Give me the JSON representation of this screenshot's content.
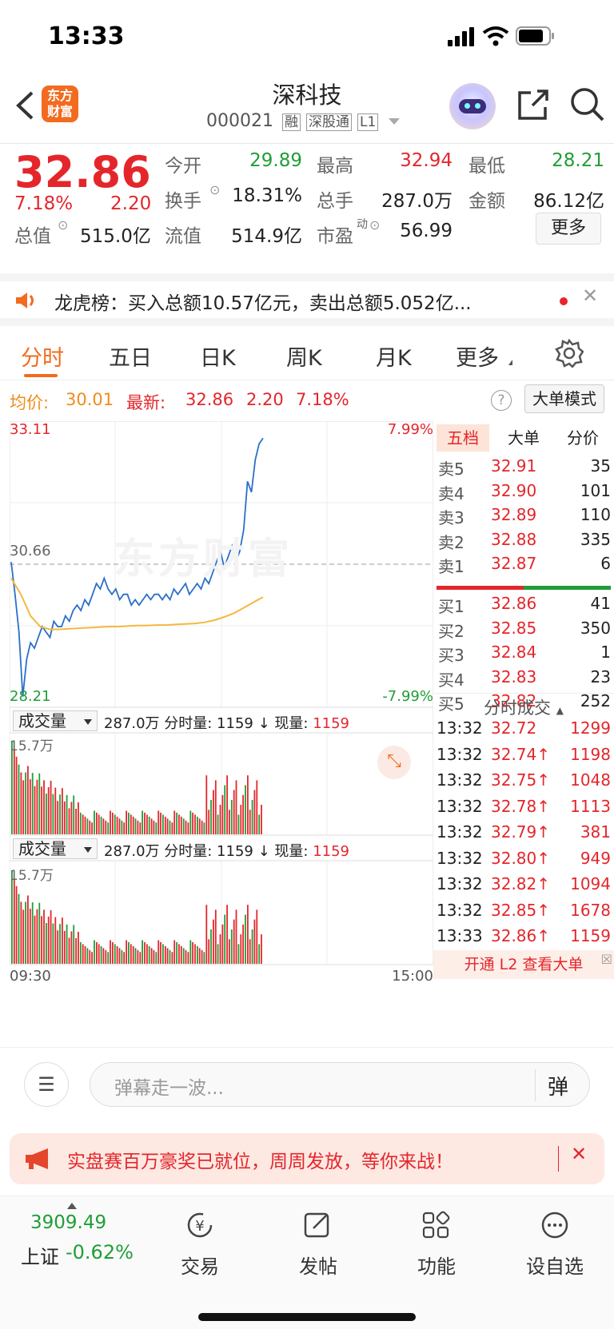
{
  "status_bar": {
    "time": "13:33"
  },
  "header": {
    "title": "深科技",
    "code": "000021",
    "tags": [
      "融",
      "深股通",
      "L1"
    ],
    "logo_text": "东方财富"
  },
  "quote": {
    "price": "32.86",
    "change_pct": "7.18%",
    "change": "2.20",
    "open_label": "今开",
    "open": "29.89",
    "high_label": "最高",
    "high": "32.94",
    "low_label": "最低",
    "low": "28.21",
    "turnover_label": "换手",
    "turnover": "18.31%",
    "volume_label": "总手",
    "volume": "287.0万",
    "amount_label": "金额",
    "amount": "86.12亿",
    "mktcap_label": "总值",
    "mktcap": "515.0亿",
    "float_label": "流值",
    "float": "514.9亿",
    "pe_label": "市盈",
    "pe_sup": "动",
    "pe": "56.99",
    "more_button": "更多"
  },
  "notice": {
    "text": "龙虎榜：买入总额10.57亿元，卖出总额5.052亿..."
  },
  "tabs": [
    "分时",
    "五日",
    "日K",
    "周K",
    "月K",
    "更多"
  ],
  "info_bar": {
    "avg_label": "均价:",
    "avg": "30.01",
    "latest_label": "最新:",
    "latest": "32.86",
    "chg": "2.20",
    "pct": "7.18%",
    "help_icon": "?",
    "mode_button": "大单模式"
  },
  "chart": {
    "y_top": "33.11",
    "y_mid": "30.66",
    "y_bottom": "28.21",
    "pct_top": "7.99%",
    "pct_bottom": "-7.99%",
    "watermark": "东方财富",
    "vol_label": "成交量",
    "vol_total": "287.0万",
    "vol_info": "分时量: 1159 ↓ 现量:",
    "vol_now": "1159",
    "vol_max": "15.7万",
    "time_start": "09:30",
    "time_end": "15:00"
  },
  "chart_data": {
    "type": "line",
    "series": [
      {
        "values": [
          30.7,
          30.1,
          29.4,
          28.2,
          28.9,
          29.2,
          29.1,
          29.3,
          29.5,
          29.4,
          29.3,
          29.6,
          29.5,
          29.5,
          29.7,
          29.6,
          29.8,
          29.9,
          29.8,
          30.0,
          29.9,
          30.1,
          30.3,
          30.2,
          30.4,
          30.2,
          30.1,
          30.2,
          30.0,
          30.1,
          30.1,
          29.9,
          30.0,
          29.9,
          30.0,
          30.1,
          30.0,
          30.1,
          30.1,
          30.0,
          30.1,
          30.0,
          30.2,
          30.1,
          30.2,
          30.3,
          30.1,
          30.2,
          30.3,
          30.2,
          30.4,
          30.3,
          30.5,
          30.7,
          30.9,
          30.6,
          30.8,
          31.0,
          30.7,
          30.9,
          31.3,
          32.2,
          32.0,
          32.6,
          32.9,
          33.0
        ]
      },
      {
        "values": [
          30.4,
          30.1,
          29.7,
          29.5,
          29.45,
          29.45,
          29.46,
          29.47,
          29.48,
          29.49,
          29.5,
          29.5,
          29.51,
          29.52,
          29.52,
          29.53,
          29.53,
          29.54,
          29.55,
          29.56,
          29.58,
          29.62,
          29.68,
          29.75,
          29.85,
          29.95,
          30.05
        ]
      }
    ],
    "ylim": [
      28.21,
      33.11
    ]
  },
  "order_book": {
    "tabs": [
      "五档",
      "大单",
      "分价"
    ],
    "asks": [
      {
        "label": "卖5",
        "price": "32.91",
        "vol": "35"
      },
      {
        "label": "卖4",
        "price": "32.90",
        "vol": "101"
      },
      {
        "label": "卖3",
        "price": "32.89",
        "vol": "110"
      },
      {
        "label": "卖2",
        "price": "32.88",
        "vol": "335"
      },
      {
        "label": "卖1",
        "price": "32.87",
        "vol": "6"
      }
    ],
    "bids": [
      {
        "label": "买1",
        "price": "32.86",
        "vol": "41"
      },
      {
        "label": "买2",
        "price": "32.85",
        "vol": "350"
      },
      {
        "label": "买3",
        "price": "32.84",
        "vol": "1"
      },
      {
        "label": "买4",
        "price": "32.83",
        "vol": "23"
      },
      {
        "label": "买5",
        "price": "32.82",
        "vol": "252"
      }
    ],
    "trades_title": "分时成交",
    "trades": [
      {
        "time": "13:32",
        "price": "32.72",
        "vol": "1299",
        "dir": "",
        "c": "red"
      },
      {
        "time": "13:32",
        "price": "32.74↑",
        "vol": "1198",
        "dir": "",
        "c": "red"
      },
      {
        "time": "13:32",
        "price": "32.75↑",
        "vol": "1048",
        "dir": "",
        "c": "red"
      },
      {
        "time": "13:32",
        "price": "32.78↑",
        "vol": "1113",
        "dir": "",
        "c": "red"
      },
      {
        "time": "13:32",
        "price": "32.79↑",
        "vol": "381",
        "dir": "",
        "c": "red"
      },
      {
        "time": "13:32",
        "price": "32.80↑",
        "vol": "949",
        "dir": "",
        "c": "red"
      },
      {
        "time": "13:32",
        "price": "32.82↑",
        "vol": "1094",
        "dir": "",
        "c": "red"
      },
      {
        "time": "13:32",
        "price": "32.85↑",
        "vol": "1678",
        "dir": "",
        "c": "red"
      },
      {
        "time": "13:33",
        "price": "32.86↑",
        "vol": "1159",
        "dir": "",
        "c": "red"
      }
    ],
    "l2_text": "开通 L2 查看大单"
  },
  "comment": {
    "placeholder": "弹幕走一波...",
    "danmu_button": "弹"
  },
  "ad": {
    "text": "实盘赛百万豪奖已就位，周周发放，等你来战！"
  },
  "tabbar": {
    "index_value": "3909.49",
    "index_name": "上证",
    "index_pct": "-0.62%",
    "items": [
      "交易",
      "发帖",
      "功能",
      "设自选"
    ]
  },
  "colors": {
    "up": "#e4262b",
    "down": "#1f9e36",
    "accent": "#f26b1f"
  }
}
